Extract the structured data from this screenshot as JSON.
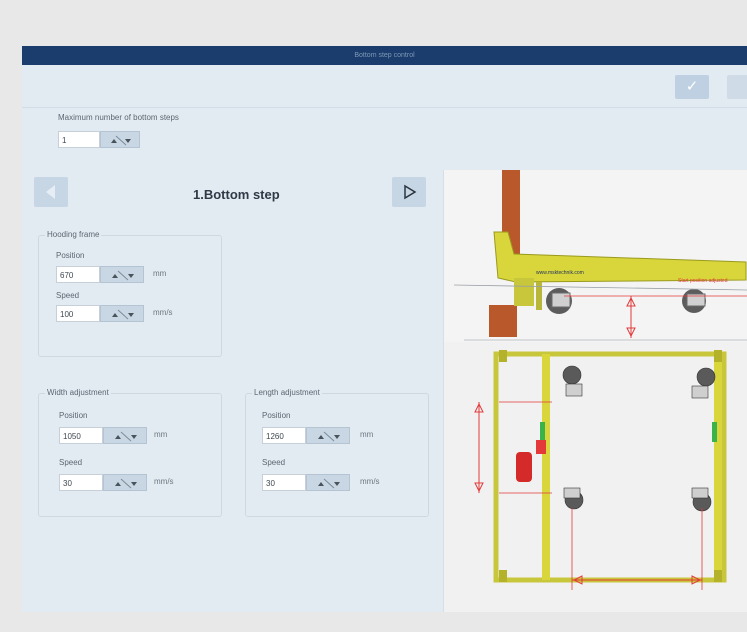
{
  "window": {
    "title": "Bottom step control"
  },
  "toolbar": {
    "confirm_icon": "check-icon"
  },
  "bottom_steps": {
    "label": "Maximum number of bottom steps",
    "value": "1"
  },
  "step": {
    "title": "1.Bottom step"
  },
  "hooding_frame": {
    "legend": "Hooding frame",
    "position_label": "Position",
    "position_value": "670",
    "position_unit": "mm",
    "speed_label": "Speed",
    "speed_value": "100",
    "speed_unit": "mm/s"
  },
  "width_adjustment": {
    "legend": "Width adjustment",
    "position_label": "Position",
    "position_value": "1050",
    "position_unit": "mm",
    "speed_label": "Speed",
    "speed_value": "30",
    "speed_unit": "mm/s"
  },
  "length_adjustment": {
    "legend": "Length adjustment",
    "position_label": "Position",
    "position_value": "1260",
    "position_unit": "mm",
    "speed_label": "Speed",
    "speed_value": "30",
    "speed_unit": "mm/s"
  },
  "diagram": {
    "brand_text": "www.msktechnik.com",
    "note_text": "Start position adjusted"
  },
  "colors": {
    "titlebar": "#1a3d6d",
    "panel": "#e3ebf2",
    "machine_yellow": "#d8d63a",
    "dimension_red": "#e3393a"
  }
}
